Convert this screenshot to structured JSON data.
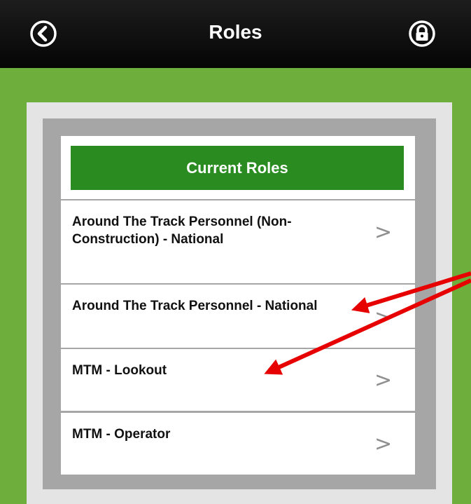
{
  "header": {
    "title": "Roles",
    "back_icon": "back-circle-icon",
    "lock_icon": "lock-circle-icon"
  },
  "list": {
    "section_title": "Current Roles",
    "items": [
      {
        "label": "Around The Track Personnel (Non-Construction) - National",
        "chevron": ">"
      },
      {
        "label": "Around The Track Personnel - National",
        "chevron": ">"
      },
      {
        "label": "MTM - Lookout",
        "chevron": ">"
      },
      {
        "label": "MTM - Operator",
        "chevron": ">"
      }
    ]
  },
  "colors": {
    "header_bg": "#0b0b0b",
    "green_bg": "#6eae3d",
    "section_bar": "#2a8c20",
    "annotation_arrow": "#e60000"
  }
}
